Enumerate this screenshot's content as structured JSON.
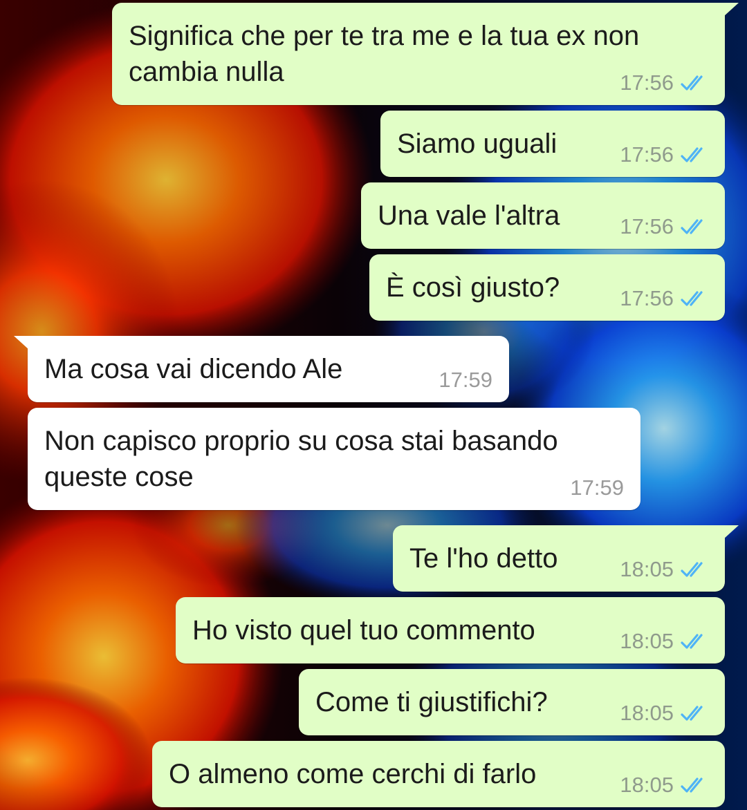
{
  "colors": {
    "outgoing_bubble": "#e1fec6",
    "incoming_bubble": "#ffffff",
    "read_tick": "#4fb3f6",
    "time_text": "#8f9a8c"
  },
  "messages": [
    {
      "direction": "outgoing",
      "text": "Significa che per te tra me e la tua ex non\ncambia nulla",
      "time": "17:56",
      "status_icon": "double-check-read-icon"
    },
    {
      "direction": "outgoing",
      "text": "Siamo uguali",
      "time": "17:56",
      "status_icon": "double-check-read-icon"
    },
    {
      "direction": "outgoing",
      "text": "Una vale l'altra",
      "time": "17:56",
      "status_icon": "double-check-read-icon"
    },
    {
      "direction": "outgoing",
      "text": "È così giusto?",
      "time": "17:56",
      "status_icon": "double-check-read-icon"
    },
    {
      "direction": "incoming",
      "text": "Ma cosa vai dicendo Ale",
      "time": "17:59"
    },
    {
      "direction": "incoming",
      "text": "Non capisco proprio su cosa stai basando\nqueste cose",
      "time": "17:59"
    },
    {
      "direction": "outgoing",
      "text": "Te l'ho detto",
      "time": "18:05",
      "status_icon": "double-check-read-icon"
    },
    {
      "direction": "outgoing",
      "text": "Ho visto quel tuo commento",
      "time": "18:05",
      "status_icon": "double-check-read-icon"
    },
    {
      "direction": "outgoing",
      "text": "Come ti giustifichi?",
      "time": "18:05",
      "status_icon": "double-check-read-icon"
    },
    {
      "direction": "outgoing",
      "text": "O almeno come cerchi di farlo",
      "time": "18:05",
      "status_icon": "double-check-read-icon"
    }
  ]
}
